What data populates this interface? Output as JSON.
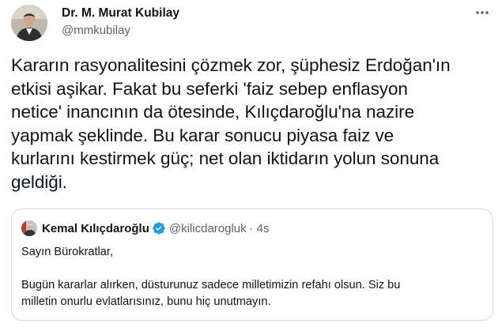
{
  "author": {
    "name": "Dr. M. Murat Kubilay",
    "handle": "@mmkubilay"
  },
  "icons": {
    "more": "more-dots-icon",
    "verified": "verified-badge-icon",
    "verified_color": "#1d9bf0"
  },
  "tweet": {
    "text": "Kararın rasyonalitesini çözmek zor, şüphesiz Erdoğan'ın\netkisi aşikar. Fakat bu seferki 'faiz sebep enflasyon\nnetice' inancının da ötesinde, Kılıçdaroğlu'na nazire\nyapmak şeklinde. Bu karar sonucu piyasa faiz ve\nkurlarını kestirmek güç; net olan iktidarın yolun sonuna\ngeldiği."
  },
  "quote": {
    "name": "Kemal Kılıçdaroğlu",
    "handle": "@kilicdarogluk",
    "separator": "·",
    "time": "4s",
    "text": "Sayın Bürokratlar,\n\nBugün kararlar alırken, düsturunuz sadece milletimizin refahı olsun. Siz bu\nmilletin onurlu evlatlarısınız, bunu hiç unutmayın."
  }
}
